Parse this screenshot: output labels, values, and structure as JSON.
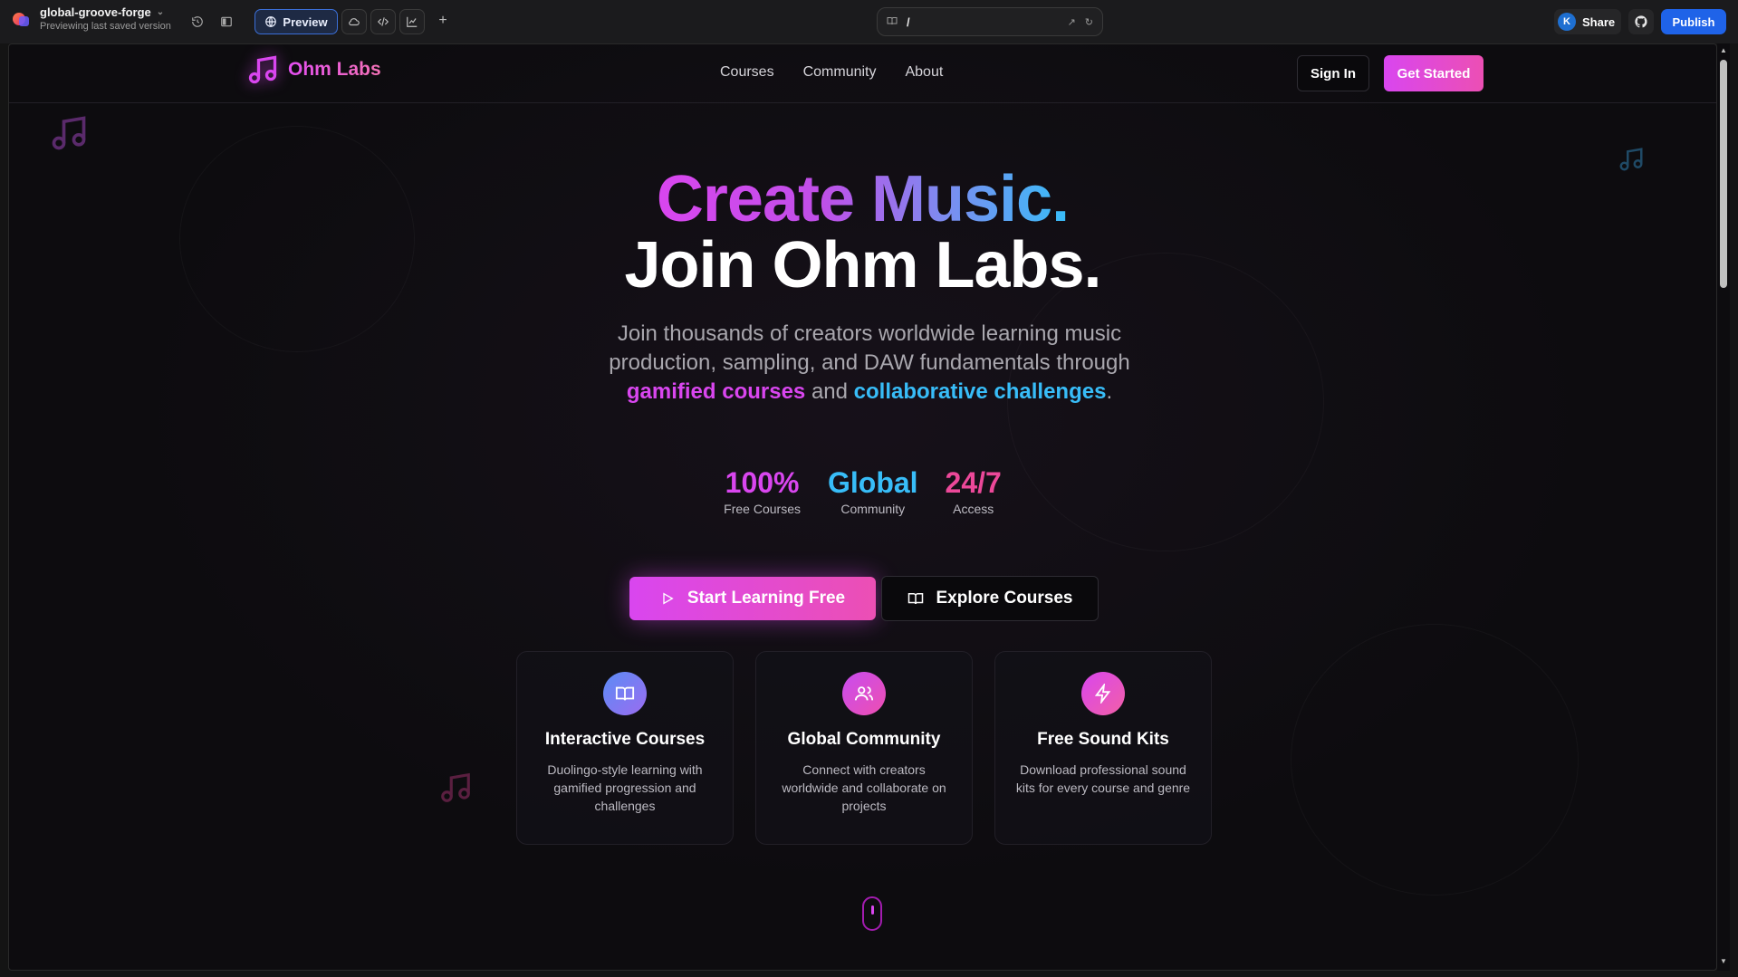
{
  "ide": {
    "project_name": "global-groove-forge",
    "project_subtitle": "Previewing last saved version",
    "preview_label": "Preview",
    "url_path": "/",
    "share_label": "Share",
    "avatar_initial": "K",
    "publish_label": "Publish"
  },
  "site": {
    "brand": "Ohm Labs",
    "nav": [
      "Courses",
      "Community",
      "About"
    ],
    "signin_label": "Sign In",
    "get_started_label": "Get Started"
  },
  "hero": {
    "line1": "Create Music.",
    "line2": "Join Ohm Labs.",
    "sub_prefix": "Join thousands of creators worldwide learning music production, sampling, and DAW fundamentals through",
    "sub_highlight1": "gamified courses",
    "sub_and": "and",
    "sub_highlight2": "collaborative challenges",
    "sub_end": "."
  },
  "stats": [
    {
      "value": "100%",
      "label": "Free Courses",
      "color": "#d946ef"
    },
    {
      "value": "Global",
      "label": "Community",
      "color": "#38bdf8"
    },
    {
      "value": "24/7",
      "label": "Access",
      "color": "#ec4899"
    }
  ],
  "cta": {
    "primary_label": "Start Learning Free",
    "secondary_label": "Explore Courses"
  },
  "features": [
    {
      "icon": "book-open-icon",
      "title": "Interactive Courses",
      "desc": "Duolingo-style learning with gamified progression and challenges",
      "gradient": [
        "#5b8cf5",
        "#9b6cf0"
      ]
    },
    {
      "icon": "users-icon",
      "title": "Global Community",
      "desc": "Connect with creators worldwide and collaborate on projects",
      "gradient": [
        "#c84cf0",
        "#ee4fb0"
      ]
    },
    {
      "icon": "zap-icon",
      "title": "Free Sound Kits",
      "desc": "Download professional sound kits for every course and genre",
      "gradient": [
        "#d946ef",
        "#f25fa6"
      ]
    }
  ],
  "colors": {
    "accent_magenta": "#d946ef",
    "accent_cyan": "#38bdf8",
    "accent_pink": "#ec4899",
    "publish_blue": "#1f63e8"
  }
}
